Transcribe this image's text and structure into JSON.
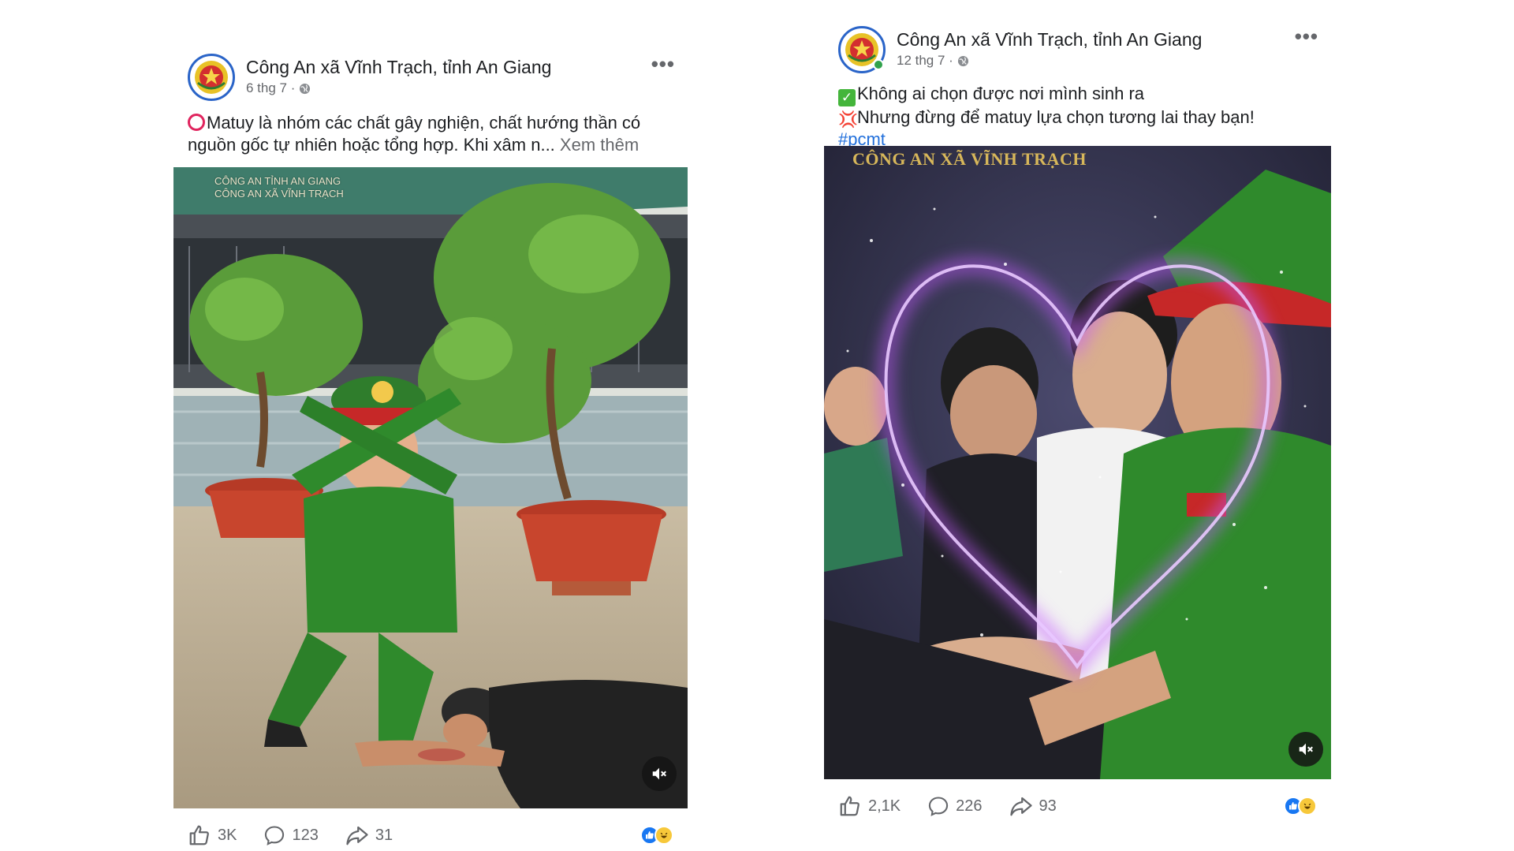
{
  "posts": [
    {
      "page_name": "Công An xã Vĩnh Trạch, tỉnh An Giang",
      "time": "6 thg 7 ·",
      "text": "Matuy là nhóm các chất gây nghiện, chất hướng thần có nguồn gốc tự nhiên hoặc tổng hợp. Khi xâm n...",
      "see_more": "Xem thêm",
      "watermark_line1": "CÔNG AN TỈNH AN GIANG",
      "watermark_line2": "CÔNG AN XÃ VĨNH TRẠCH",
      "likes": "3K",
      "comments": "123",
      "shares": "31"
    },
    {
      "page_name": "Công An xã Vĩnh Trạch, tỉnh An Giang",
      "time": "12 thg 7 ·",
      "line1": "Không ai chọn được nơi mình sinh ra",
      "line2": "Nhưng đừng để matuy lựa chọn tương lai thay bạn!",
      "hashtag": "#pcmt",
      "watermark": "CÔNG AN XÃ VĨNH TRẠCH",
      "likes": "2,1K",
      "comments": "226",
      "shares": "93"
    }
  ],
  "colors": {
    "uniform_green": "#2f8a2c",
    "brand_blue": "#1877f2",
    "text_secondary": "#65676b"
  }
}
